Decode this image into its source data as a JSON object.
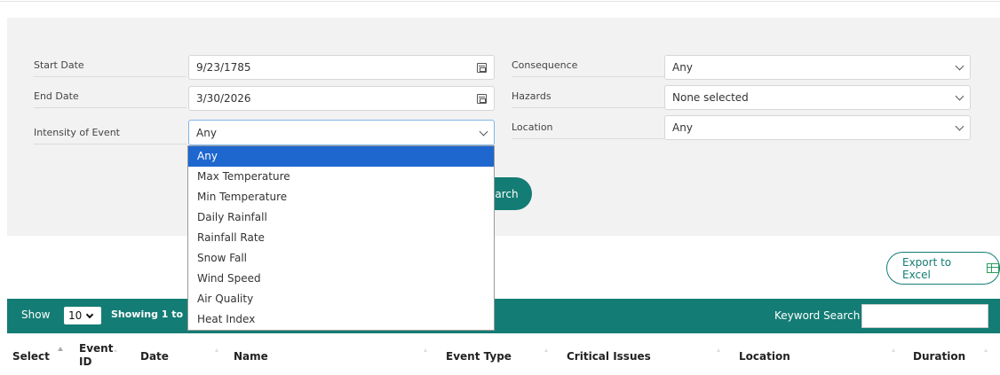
{
  "filters": {
    "start_date": {
      "label": "Start Date",
      "value": "9/23/1785"
    },
    "end_date": {
      "label": "End Date",
      "value": "3/30/2026"
    },
    "intensity": {
      "label": "Intensity of Event",
      "value": "Any"
    },
    "consequence": {
      "label": "Consequence",
      "value": "Any"
    },
    "hazards": {
      "label": "Hazards",
      "value": "None selected"
    },
    "location": {
      "label": "Location",
      "value": "Any"
    },
    "search_label": "earch"
  },
  "intensity_options": [
    "Any",
    "Max Temperature",
    "Min Temperature",
    "Daily Rainfall",
    "Rainfall Rate",
    "Snow Fall",
    "Wind Speed",
    "Air Quality",
    "Heat Index"
  ],
  "export_label": "Export to Excel",
  "table_toolbar": {
    "show_label": "Show",
    "page_size": "10",
    "showing_text": "Showing 1 to 10 of",
    "keyword_label": "Keyword Search"
  },
  "columns": {
    "select": "Select",
    "event_id_1": "Event",
    "event_id_2": "ID",
    "date": "Date",
    "name": "Name",
    "event_type": "Event Type",
    "critical_issues": "Critical Issues",
    "location": "Location",
    "duration": "Duration"
  },
  "colors": {
    "accent": "#137c74",
    "dropdown_highlight": "#1e67cf",
    "panel_bg": "#f2f2f2"
  }
}
